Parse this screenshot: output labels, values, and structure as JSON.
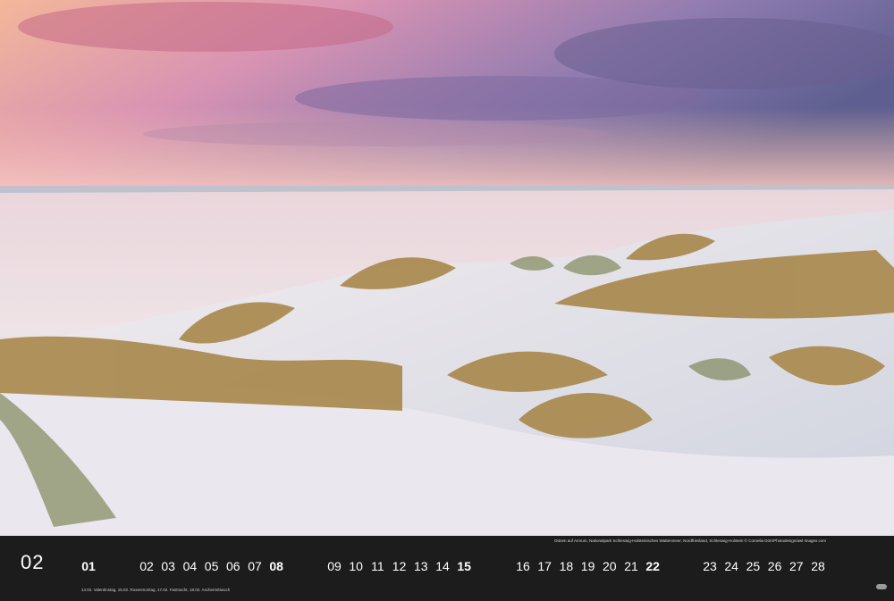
{
  "photo": {
    "subject": "beach-dunes-photo"
  },
  "strip": {
    "caption": "Dünen auf Amrum, Nationalpark Schleswig-Holsteinisches Wattenmeer, Nordfriesland, Schleswig-Holstein © Cornelia Dörr/Photodesign/awl-images.com",
    "month": "02",
    "days": [
      {
        "label": "01",
        "bold": true
      },
      {
        "label": "02",
        "bold": false
      },
      {
        "label": "03",
        "bold": false
      },
      {
        "label": "04",
        "bold": false
      },
      {
        "label": "05",
        "bold": false
      },
      {
        "label": "06",
        "bold": false
      },
      {
        "label": "07",
        "bold": false
      },
      {
        "label": "08",
        "bold": true
      },
      {
        "label": "09",
        "bold": false
      },
      {
        "label": "10",
        "bold": false
      },
      {
        "label": "11",
        "bold": false
      },
      {
        "label": "12",
        "bold": false
      },
      {
        "label": "13",
        "bold": false
      },
      {
        "label": "14",
        "bold": false
      },
      {
        "label": "15",
        "bold": true
      },
      {
        "label": "16",
        "bold": false
      },
      {
        "label": "17",
        "bold": false
      },
      {
        "label": "18",
        "bold": false
      },
      {
        "label": "19",
        "bold": false
      },
      {
        "label": "20",
        "bold": false
      },
      {
        "label": "21",
        "bold": false
      },
      {
        "label": "22",
        "bold": true
      },
      {
        "label": "23",
        "bold": false
      },
      {
        "label": "24",
        "bold": false
      },
      {
        "label": "25",
        "bold": false
      },
      {
        "label": "26",
        "bold": false
      },
      {
        "label": "27",
        "bold": false
      },
      {
        "label": "28",
        "bold": false
      }
    ],
    "holidays": "14.02. Valentinstag, 16.02. Rosenmontag, 17.02. Fastnacht, 18.02. Aschermittwoch"
  },
  "colors": {
    "strip_bg": "#1c1c1c",
    "text": "#ffffff"
  }
}
